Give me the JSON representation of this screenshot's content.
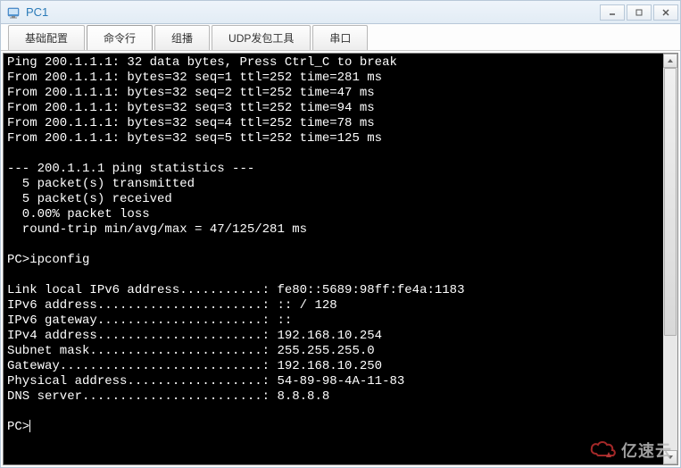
{
  "window": {
    "title": "PC1"
  },
  "tabs": [
    {
      "label": "基础配置",
      "active": false
    },
    {
      "label": "命令行",
      "active": true
    },
    {
      "label": "组播",
      "active": false
    },
    {
      "label": "UDP发包工具",
      "active": false
    },
    {
      "label": "串口",
      "active": false
    }
  ],
  "terminal": {
    "lines": [
      "Ping 200.1.1.1: 32 data bytes, Press Ctrl_C to break",
      "From 200.1.1.1: bytes=32 seq=1 ttl=252 time=281 ms",
      "From 200.1.1.1: bytes=32 seq=2 ttl=252 time=47 ms",
      "From 200.1.1.1: bytes=32 seq=3 ttl=252 time=94 ms",
      "From 200.1.1.1: bytes=32 seq=4 ttl=252 time=78 ms",
      "From 200.1.1.1: bytes=32 seq=5 ttl=252 time=125 ms",
      "",
      "--- 200.1.1.1 ping statistics ---",
      "  5 packet(s) transmitted",
      "  5 packet(s) received",
      "  0.00% packet loss",
      "  round-trip min/avg/max = 47/125/281 ms",
      "",
      "PC>ipconfig",
      "",
      "Link local IPv6 address...........: fe80::5689:98ff:fe4a:1183",
      "IPv6 address......................: :: / 128",
      "IPv6 gateway......................: ::",
      "IPv4 address......................: 192.168.10.254",
      "Subnet mask.......................: 255.255.255.0",
      "Gateway...........................: 192.168.10.250",
      "Physical address..................: 54-89-98-4A-11-83",
      "DNS server........................: 8.8.8.8",
      "",
      ""
    ],
    "prompt": "PC>"
  },
  "watermark": {
    "text": "亿速云"
  }
}
